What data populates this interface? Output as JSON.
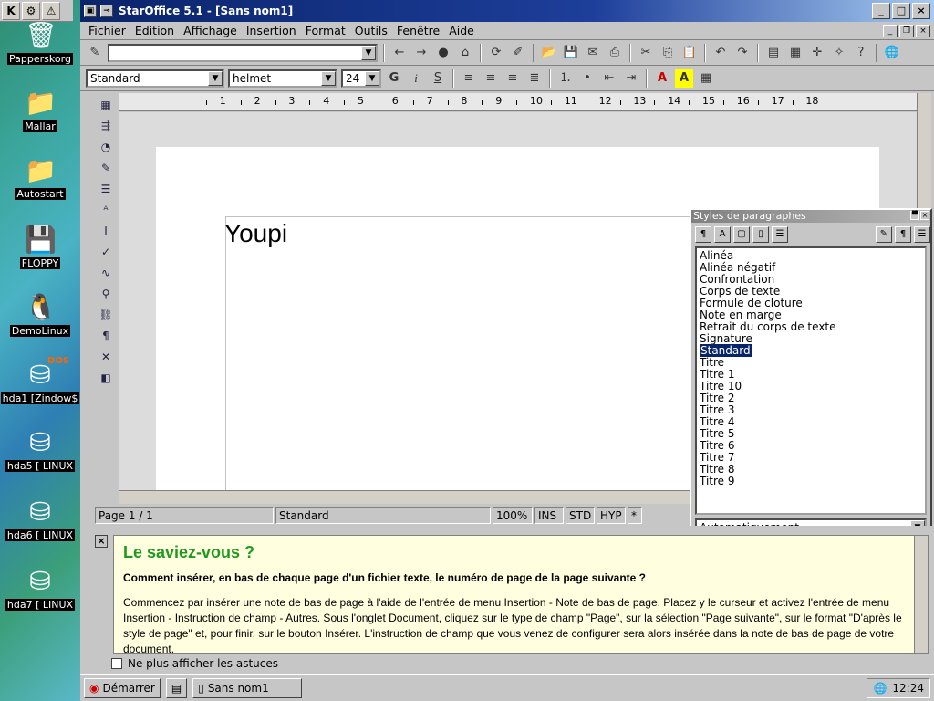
{
  "desktop": {
    "kde_buttons": [
      "K",
      "⚙",
      "⚠"
    ],
    "icons": [
      {
        "label": "Papperskorg",
        "icon": "trash-icon",
        "glyph": "🗑"
      },
      {
        "label": "Mallar",
        "icon": "folder-icon",
        "glyph": "📁"
      },
      {
        "label": "Autostart",
        "icon": "folder-icon",
        "glyph": "📁"
      },
      {
        "label": "FLOPPY",
        "icon": "floppy-icon",
        "glyph": "💾"
      },
      {
        "label": "DemoLinux",
        "icon": "penguin-icon",
        "glyph": "🐧"
      },
      {
        "label": "hda1 [Zindow$",
        "icon": "harddisk-icon",
        "glyph": "⛁",
        "badge": "DOS"
      },
      {
        "label": "hda5 [ LINUX",
        "icon": "harddisk-icon",
        "glyph": "⛁"
      },
      {
        "label": "hda6 [ LINUX",
        "icon": "harddisk-icon",
        "glyph": "⛁"
      },
      {
        "label": "hda7 [ LINUX",
        "icon": "harddisk-icon",
        "glyph": "⛁"
      }
    ]
  },
  "window": {
    "title": "StarOffice 5.1 - [Sans nom1]",
    "controls": {
      "minimize": "_",
      "maximize": "□",
      "close": "×"
    }
  },
  "menu": [
    "Fichier",
    "Edition",
    "Affichage",
    "Insertion",
    "Format",
    "Outils",
    "Fenêtre",
    "Aide"
  ],
  "format_bar": {
    "style": "Standard",
    "font": "helmet",
    "size": "24"
  },
  "ruler": {
    "numbers": [
      "1",
      "2",
      "3",
      "4",
      "5",
      "6",
      "7",
      "8",
      "9",
      "10",
      "11",
      "12",
      "13",
      "14",
      "15",
      "16",
      "17",
      "18"
    ]
  },
  "document": {
    "text": "Youpi"
  },
  "status": {
    "page": "Page 1 / 1",
    "style": "Standard",
    "zoom": "100%",
    "ins": "INS",
    "std": "STD",
    "hyp": "HYP",
    "mod": "*"
  },
  "stylist": {
    "title": "Styles de paragraphes",
    "items": [
      "Alinéa",
      "Alinéa négatif",
      "Confrontation",
      "Corps de texte",
      "Formule de cloture",
      "Note en marge",
      "Retrait du corps de texte",
      "Signature",
      "Standard",
      "Titre",
      "Titre 1",
      "Titre 10",
      "Titre 2",
      "Titre 3",
      "Titre 4",
      "Titre 5",
      "Titre 6",
      "Titre 7",
      "Titre 8",
      "Titre 9"
    ],
    "selected": "Standard",
    "filter": "Automatiquement"
  },
  "tip": {
    "heading": "Le saviez-vous ?",
    "question": "Comment insérer, en bas de chaque page d'un fichier texte, le numéro de page de la page suivante ?",
    "body": "Commencez par insérer une note de bas de page à l'aide de l'entrée de menu Insertion - Note de bas de page. Placez y le curseur et activez l'entrée de menu Insertion - Instruction de champ - Autres. Sous l'onglet Document, cliquez sur le type de champ \"Page\", sur la sélection \"Page suivante\", sur le format \"D'après le style de page\" et, pour finir, sur le bouton Insérer. L'instruction de champ que vous venez de configurer sera alors insérée dans la note de bas de page de votre document.",
    "no_more": "Ne plus afficher les astuces"
  },
  "taskbar": {
    "start": "Démarrer",
    "task": "Sans nom1",
    "clock": "12:24"
  },
  "colors": {
    "title_start": "#0a246a",
    "tip_heading": "#1f9a1f",
    "selection": "#0a246a"
  }
}
